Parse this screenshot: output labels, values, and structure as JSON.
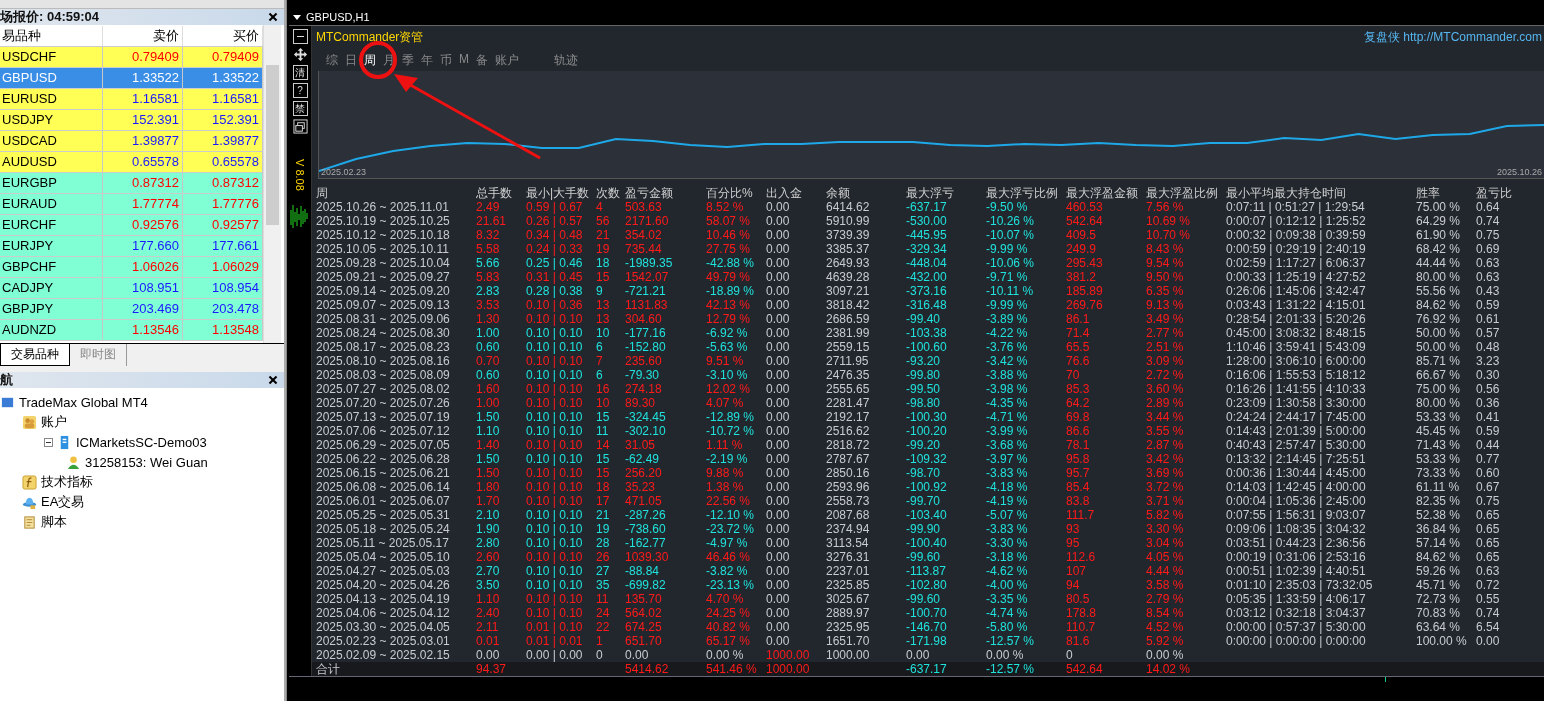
{
  "market_watch": {
    "title": "场报价: 04:59:04",
    "columns": [
      "易品种",
      "卖价",
      "买价"
    ],
    "rows": [
      {
        "symbol": "USDCHF",
        "bid": "0.79409",
        "ask": "0.79409",
        "rising": false,
        "color": "#ffff55",
        "selected": false
      },
      {
        "symbol": "GBPUSD",
        "bid": "1.33522",
        "ask": "1.33522",
        "rising": false,
        "selected": true
      },
      {
        "symbol": "EURUSD",
        "bid": "1.16581",
        "ask": "1.16581",
        "rising": true,
        "color": "#ffff55",
        "selected": false
      },
      {
        "symbol": "USDJPY",
        "bid": "152.391",
        "ask": "152.391",
        "rising": true,
        "color": "#ffff55",
        "selected": false
      },
      {
        "symbol": "USDCAD",
        "bid": "1.39877",
        "ask": "1.39877",
        "rising": true,
        "color": "#ffff55",
        "selected": false
      },
      {
        "symbol": "AUDUSD",
        "bid": "0.65578",
        "ask": "0.65578",
        "rising": true,
        "color": "#ffff55",
        "selected": false
      },
      {
        "symbol": "EURGBP",
        "bid": "0.87312",
        "ask": "0.87312",
        "rising": false,
        "color": "#80ffd4",
        "selected": false
      },
      {
        "symbol": "EURAUD",
        "bid": "1.77774",
        "ask": "1.77776",
        "rising": false,
        "color": "#80ffd4",
        "selected": false
      },
      {
        "symbol": "EURCHF",
        "bid": "0.92576",
        "ask": "0.92577",
        "rising": false,
        "color": "#80ffd4",
        "selected": false
      },
      {
        "symbol": "EURJPY",
        "bid": "177.660",
        "ask": "177.661",
        "rising": true,
        "color": "#80ffd4",
        "selected": false
      },
      {
        "symbol": "GBPCHF",
        "bid": "1.06026",
        "ask": "1.06029",
        "rising": false,
        "color": "#80ffd4",
        "selected": false
      },
      {
        "symbol": "CADJPY",
        "bid": "108.951",
        "ask": "108.954",
        "rising": true,
        "color": "#80ffd4",
        "selected": false
      },
      {
        "symbol": "GBPJPY",
        "bid": "203.469",
        "ask": "203.478",
        "rising": true,
        "color": "#80ffd4",
        "selected": false
      },
      {
        "symbol": "AUDNZD",
        "bid": "1.13546",
        "ask": "1.13548",
        "rising": false,
        "color": "#80ffd4",
        "selected": false
      }
    ],
    "tabs": [
      {
        "label": "交易品种",
        "selected": true
      },
      {
        "label": "即时图",
        "selected": false
      }
    ]
  },
  "navigator": {
    "title": "航",
    "tree": [
      {
        "label": "TradeMax Global MT4",
        "kind": "terminal",
        "children": [
          {
            "label": "账户",
            "kind": "accounts",
            "children": [
              {
                "label": "ICMarketsSC-Demo03",
                "kind": "server",
                "children": [
                  {
                    "label": "31258153: Wei Guan",
                    "kind": "user"
                  }
                ]
              }
            ]
          },
          {
            "label": "技术指标",
            "kind": "indicators"
          },
          {
            "label": "EA交易",
            "kind": "experts"
          },
          {
            "label": "脚本",
            "kind": "scripts"
          }
        ]
      }
    ]
  },
  "chart_window": {
    "title": "GBPUSD,H1",
    "toolbar": [
      "清",
      "?",
      "禁"
    ],
    "version": "V 8.08",
    "brand": "MTCommander资管",
    "site": "复盘侠 http://MTCommander.com",
    "tabs": [
      {
        "label": "综",
        "selected": false
      },
      {
        "label": "日",
        "selected": false
      },
      {
        "label": "周",
        "selected": true
      },
      {
        "label": "月",
        "selected": false
      },
      {
        "label": "季",
        "selected": false
      },
      {
        "label": "年",
        "selected": false
      },
      {
        "label": "币",
        "selected": false
      },
      {
        "label": "M",
        "selected": false
      },
      {
        "label": "备",
        "selected": false
      },
      {
        "label": "账户",
        "selected": false
      },
      {
        "label": "轨迹",
        "selected": false
      }
    ],
    "equity_chart": {
      "start_label": "2025.02.23",
      "end_label": "2025.10.26"
    },
    "table": {
      "columns": [
        "周",
        "总手数",
        "最小|大手数",
        "次数",
        "盈亏金额",
        "百分比%",
        "出入金",
        "余额",
        "最大浮亏",
        "最大浮亏比例",
        "最大浮盈金额",
        "最大浮盈比例",
        "最小平均最大持仓时间",
        "胜率",
        "盈亏比"
      ],
      "rows": [
        {
          "kind": "week",
          "profit": true,
          "cells": [
            "2025.10.26 ~ 2025.11.01",
            "2.49",
            "0.59 | 0.67",
            "4",
            "503.63",
            "8.52 %",
            "0.00",
            "6414.62",
            "-637.17",
            "-9.50 %",
            "460.53",
            "7.56 %",
            "0:07:11 | 0:51:27 | 1:29:54",
            "75.00 %",
            "0.64"
          ]
        },
        {
          "kind": "week",
          "profit": true,
          "cells": [
            "2025.10.19 ~ 2025.10.25",
            "21.61",
            "0.26 | 0.57",
            "56",
            "2171.60",
            "58.07 %",
            "0.00",
            "5910.99",
            "-530.00",
            "-10.26 %",
            "542.64",
            "10.69 %",
            "0:00:07 | 0:12:12 | 1:25:52",
            "64.29 %",
            "0.74"
          ]
        },
        {
          "kind": "week",
          "profit": true,
          "cells": [
            "2025.10.12 ~ 2025.10.18",
            "8.32",
            "0.34 | 0.48",
            "21",
            "354.02",
            "10.46 %",
            "0.00",
            "3739.39",
            "-445.95",
            "-10.07 %",
            "409.5",
            "10.70 %",
            "0:00:32 | 0:09:38 | 0:39:59",
            "61.90 %",
            "0.75"
          ]
        },
        {
          "kind": "week",
          "profit": true,
          "cells": [
            "2025.10.05 ~ 2025.10.11",
            "5.58",
            "0.24 | 0.33",
            "19",
            "735.44",
            "27.75 %",
            "0.00",
            "3385.37",
            "-329.34",
            "-9.99 %",
            "249.9",
            "8.43 %",
            "0:00:59 | 0:29:19 | 2:40:19",
            "68.42 %",
            "0.69"
          ]
        },
        {
          "kind": "week",
          "profit": false,
          "cells": [
            "2025.09.28 ~ 2025.10.04",
            "5.66",
            "0.25 | 0.46",
            "18",
            "-1989.35",
            "-42.88 %",
            "0.00",
            "2649.93",
            "-448.04",
            "-10.06 %",
            "295.43",
            "9.54 %",
            "0:02:59 | 1:17:27 | 6:06:37",
            "44.44 %",
            "0.63"
          ]
        },
        {
          "kind": "week",
          "profit": true,
          "cells": [
            "2025.09.21 ~ 2025.09.27",
            "5.83",
            "0.31 | 0.45",
            "15",
            "1542.07",
            "49.79 %",
            "0.00",
            "4639.28",
            "-432.00",
            "-9.71 %",
            "381.2",
            "9.50 %",
            "0:00:33 | 1:25:19 | 4:27:52",
            "80.00 %",
            "0.63"
          ]
        },
        {
          "kind": "week",
          "profit": false,
          "cells": [
            "2025.09.14 ~ 2025.09.20",
            "2.83",
            "0.28 | 0.38",
            "9",
            "-721.21",
            "-18.89 %",
            "0.00",
            "3097.21",
            "-373.16",
            "-10.11 %",
            "185.89",
            "6.35 %",
            "0:26:06 | 1:45:06 | 3:42:47",
            "55.56 %",
            "0.43"
          ]
        },
        {
          "kind": "week",
          "profit": true,
          "cells": [
            "2025.09.07 ~ 2025.09.13",
            "3.53",
            "0.10 | 0.36",
            "13",
            "1131.83",
            "42.13 %",
            "0.00",
            "3818.42",
            "-316.48",
            "-9.99 %",
            "269.76",
            "9.13 %",
            "0:03:43 | 1:31:22 | 4:15:01",
            "84.62 %",
            "0.59"
          ]
        },
        {
          "kind": "week",
          "profit": true,
          "cells": [
            "2025.08.31 ~ 2025.09.06",
            "1.30",
            "0.10 | 0.10",
            "13",
            "304.60",
            "12.79 %",
            "0.00",
            "2686.59",
            "-99.40",
            "-3.89 %",
            "86.1",
            "3.49 %",
            "0:28:54 | 2:01:33 | 5:20:26",
            "76.92 %",
            "0.61"
          ]
        },
        {
          "kind": "week",
          "profit": false,
          "cells": [
            "2025.08.24 ~ 2025.08.30",
            "1.00",
            "0.10 | 0.10",
            "10",
            "-177.16",
            "-6.92 %",
            "0.00",
            "2381.99",
            "-103.38",
            "-4.22 %",
            "71.4",
            "2.77 %",
            "0:45:00 | 3:08:32 | 8:48:15",
            "50.00 %",
            "0.57"
          ]
        },
        {
          "kind": "week",
          "profit": false,
          "cells": [
            "2025.08.17 ~ 2025.08.23",
            "0.60",
            "0.10 | 0.10",
            "6",
            "-152.80",
            "-5.63 %",
            "0.00",
            "2559.15",
            "-100.60",
            "-3.76 %",
            "65.5",
            "2.51 %",
            "1:10:46 | 3:59:41 | 5:43:09",
            "50.00 %",
            "0.48"
          ]
        },
        {
          "kind": "week",
          "profit": true,
          "cells": [
            "2025.08.10 ~ 2025.08.16",
            "0.70",
            "0.10 | 0.10",
            "7",
            "235.60",
            "9.51 %",
            "0.00",
            "2711.95",
            "-93.20",
            "-3.42 %",
            "76.6",
            "3.09 %",
            "1:28:00 | 3:06:10 | 6:00:00",
            "85.71 %",
            "3.23"
          ]
        },
        {
          "kind": "week",
          "profit": false,
          "cells": [
            "2025.08.03 ~ 2025.08.09",
            "0.60",
            "0.10 | 0.10",
            "6",
            "-79.30",
            "-3.10 %",
            "0.00",
            "2476.35",
            "-99.80",
            "-3.88 %",
            "70",
            "2.72 %",
            "0:16:06 | 1:55:53 | 5:18:12",
            "66.67 %",
            "0.30"
          ]
        },
        {
          "kind": "week",
          "profit": true,
          "cells": [
            "2025.07.27 ~ 2025.08.02",
            "1.60",
            "0.10 | 0.10",
            "16",
            "274.18",
            "12.02 %",
            "0.00",
            "2555.65",
            "-99.50",
            "-3.98 %",
            "85.3",
            "3.60 %",
            "0:16:26 | 1:41:55 | 4:10:33",
            "75.00 %",
            "0.56"
          ]
        },
        {
          "kind": "week",
          "profit": true,
          "cells": [
            "2025.07.20 ~ 2025.07.26",
            "1.00",
            "0.10 | 0.10",
            "10",
            "89.30",
            "4.07 %",
            "0.00",
            "2281.47",
            "-98.80",
            "-4.35 %",
            "64.2",
            "2.89 %",
            "0:23:09 | 1:30:58 | 3:30:00",
            "80.00 %",
            "0.36"
          ]
        },
        {
          "kind": "week",
          "profit": false,
          "cells": [
            "2025.07.13 ~ 2025.07.19",
            "1.50",
            "0.10 | 0.10",
            "15",
            "-324.45",
            "-12.89 %",
            "0.00",
            "2192.17",
            "-100.30",
            "-4.71 %",
            "69.8",
            "3.44 %",
            "0:24:24 | 2:44:17 | 7:45:00",
            "53.33 %",
            "0.41"
          ]
        },
        {
          "kind": "week",
          "profit": false,
          "cells": [
            "2025.07.06 ~ 2025.07.12",
            "1.10",
            "0.10 | 0.10",
            "11",
            "-302.10",
            "-10.72 %",
            "0.00",
            "2516.62",
            "-100.20",
            "-3.99 %",
            "86.6",
            "3.55 %",
            "0:14:43 | 2:01:39 | 5:00:00",
            "45.45 %",
            "0.59"
          ]
        },
        {
          "kind": "week",
          "profit": true,
          "cells": [
            "2025.06.29 ~ 2025.07.05",
            "1.40",
            "0.10 | 0.10",
            "14",
            "31.05",
            "1.11 %",
            "0.00",
            "2818.72",
            "-99.20",
            "-3.68 %",
            "78.1",
            "2.87 %",
            "0:40:43 | 2:57:47 | 5:30:00",
            "71.43 %",
            "0.44"
          ]
        },
        {
          "kind": "week",
          "profit": false,
          "cells": [
            "2025.06.22 ~ 2025.06.28",
            "1.50",
            "0.10 | 0.10",
            "15",
            "-62.49",
            "-2.19 %",
            "0.00",
            "2787.67",
            "-109.32",
            "-3.97 %",
            "95.8",
            "3.42 %",
            "0:13:32 | 2:14:45 | 7:25:51",
            "53.33 %",
            "0.77"
          ]
        },
        {
          "kind": "week",
          "profit": true,
          "cells": [
            "2025.06.15 ~ 2025.06.21",
            "1.50",
            "0.10 | 0.10",
            "15",
            "256.20",
            "9.88 %",
            "0.00",
            "2850.16",
            "-98.70",
            "-3.83 %",
            "95.7",
            "3.69 %",
            "0:00:36 | 1:30:44 | 4:45:00",
            "73.33 %",
            "0.60"
          ]
        },
        {
          "kind": "week",
          "profit": true,
          "cells": [
            "2025.06.08 ~ 2025.06.14",
            "1.80",
            "0.10 | 0.10",
            "18",
            "35.23",
            "1.38 %",
            "0.00",
            "2593.96",
            "-100.92",
            "-4.18 %",
            "85.4",
            "3.72 %",
            "0:14:03 | 1:42:45 | 4:00:00",
            "61.11 %",
            "0.67"
          ]
        },
        {
          "kind": "week",
          "profit": true,
          "cells": [
            "2025.06.01 ~ 2025.06.07",
            "1.70",
            "0.10 | 0.10",
            "17",
            "471.05",
            "22.56 %",
            "0.00",
            "2558.73",
            "-99.70",
            "-4.19 %",
            "83.8",
            "3.71 %",
            "0:00:04 | 1:05:36 | 2:45:00",
            "82.35 %",
            "0.75"
          ]
        },
        {
          "kind": "week",
          "profit": false,
          "cells": [
            "2025.05.25 ~ 2025.05.31",
            "2.10",
            "0.10 | 0.10",
            "21",
            "-287.26",
            "-12.10 %",
            "0.00",
            "2087.68",
            "-103.40",
            "-5.07 %",
            "111.7",
            "5.82 %",
            "0:07:55 | 1:56:31 | 9:03:07",
            "52.38 %",
            "0.65"
          ]
        },
        {
          "kind": "week",
          "profit": false,
          "cells": [
            "2025.05.18 ~ 2025.05.24",
            "1.90",
            "0.10 | 0.10",
            "19",
            "-738.60",
            "-23.72 %",
            "0.00",
            "2374.94",
            "-99.90",
            "-3.83 %",
            "93",
            "3.30 %",
            "0:09:06 | 1:08:35 | 3:04:32",
            "36.84 %",
            "0.65"
          ]
        },
        {
          "kind": "week",
          "profit": false,
          "cells": [
            "2025.05.11 ~ 2025.05.17",
            "2.80",
            "0.10 | 0.10",
            "28",
            "-162.77",
            "-4.97 %",
            "0.00",
            "3113.54",
            "-100.40",
            "-3.30 %",
            "95",
            "3.04 %",
            "0:03:51 | 0:44:23 | 2:36:56",
            "57.14 %",
            "0.65"
          ]
        },
        {
          "kind": "week",
          "profit": true,
          "cells": [
            "2025.05.04 ~ 2025.05.10",
            "2.60",
            "0.10 | 0.10",
            "26",
            "1039.30",
            "46.46 %",
            "0.00",
            "3276.31",
            "-99.60",
            "-3.18 %",
            "112.6",
            "4.05 %",
            "0:00:19 | 0:31:06 | 2:53:16",
            "84.62 %",
            "0.65"
          ]
        },
        {
          "kind": "week",
          "profit": false,
          "cells": [
            "2025.04.27 ~ 2025.05.03",
            "2.70",
            "0.10 | 0.10",
            "27",
            "-88.84",
            "-3.82 %",
            "0.00",
            "2237.01",
            "-113.87",
            "-4.62 %",
            "107",
            "4.44 %",
            "0:00:51 | 1:02:39 | 4:40:51",
            "59.26 %",
            "0.63"
          ]
        },
        {
          "kind": "week",
          "profit": false,
          "cells": [
            "2025.04.20 ~ 2025.04.26",
            "3.50",
            "0.10 | 0.10",
            "35",
            "-699.82",
            "-23.13 %",
            "0.00",
            "2325.85",
            "-102.80",
            "-4.00 %",
            "94",
            "3.58 %",
            "0:01:10 | 2:35:03 | 73:32:05",
            "45.71 %",
            "0.72"
          ]
        },
        {
          "kind": "week",
          "profit": true,
          "cells": [
            "2025.04.13 ~ 2025.04.19",
            "1.10",
            "0.10 | 0.10",
            "11",
            "135.70",
            "4.70 %",
            "0.00",
            "3025.67",
            "-99.60",
            "-3.35 %",
            "80.5",
            "2.79 %",
            "0:05:35 | 1:33:59 | 4:06:17",
            "72.73 %",
            "0.55"
          ]
        },
        {
          "kind": "week",
          "profit": true,
          "cells": [
            "2025.04.06 ~ 2025.04.12",
            "2.40",
            "0.10 | 0.10",
            "24",
            "564.02",
            "24.25 %",
            "0.00",
            "2889.97",
            "-100.70",
            "-4.74 %",
            "178.8",
            "8.54 %",
            "0:03:12 | 0:32:18 | 3:04:37",
            "70.83 %",
            "0.74"
          ]
        },
        {
          "kind": "week",
          "profit": true,
          "cells": [
            "2025.03.30 ~ 2025.04.05",
            "2.11",
            "0.01 | 0.10",
            "22",
            "674.25",
            "40.82 %",
            "0.00",
            "2325.95",
            "-146.70",
            "-5.80 %",
            "110.7",
            "4.52 %",
            "0:00:00 | 0:57:37 | 5:30:00",
            "63.64 %",
            "6.54"
          ]
        },
        {
          "kind": "week",
          "profit": true,
          "cells": [
            "2025.02.23 ~ 2025.03.01",
            "0.01",
            "0.01 | 0.01",
            "1",
            "651.70",
            "65.17 %",
            "0.00",
            "1651.70",
            "-171.98",
            "-12.57 %",
            "81.6",
            "5.92 %",
            "0:00:00 | 0:00:00 | 0:00:00",
            "100.00 %",
            "0.00"
          ]
        },
        {
          "kind": "initial",
          "cells": [
            "2025.02.09 ~ 2025.02.15",
            "0.00",
            "0.00 | 0.00",
            "0",
            "0.00",
            "0.00 %",
            "1000.00",
            "1000.00",
            "0.00",
            "0.00 %",
            "0",
            "0.00 %"
          ]
        }
      ],
      "total": {
        "label": "合计",
        "lots": "94.37",
        "pnl": "5414.62",
        "percent": "541.46 %",
        "deposit": "1000.00",
        "max_loss": "-637.17",
        "max_loss_ratio": "-12.57 %",
        "max_profit": "542.64",
        "max_profit_ratio": "14.02 %"
      }
    }
  }
}
